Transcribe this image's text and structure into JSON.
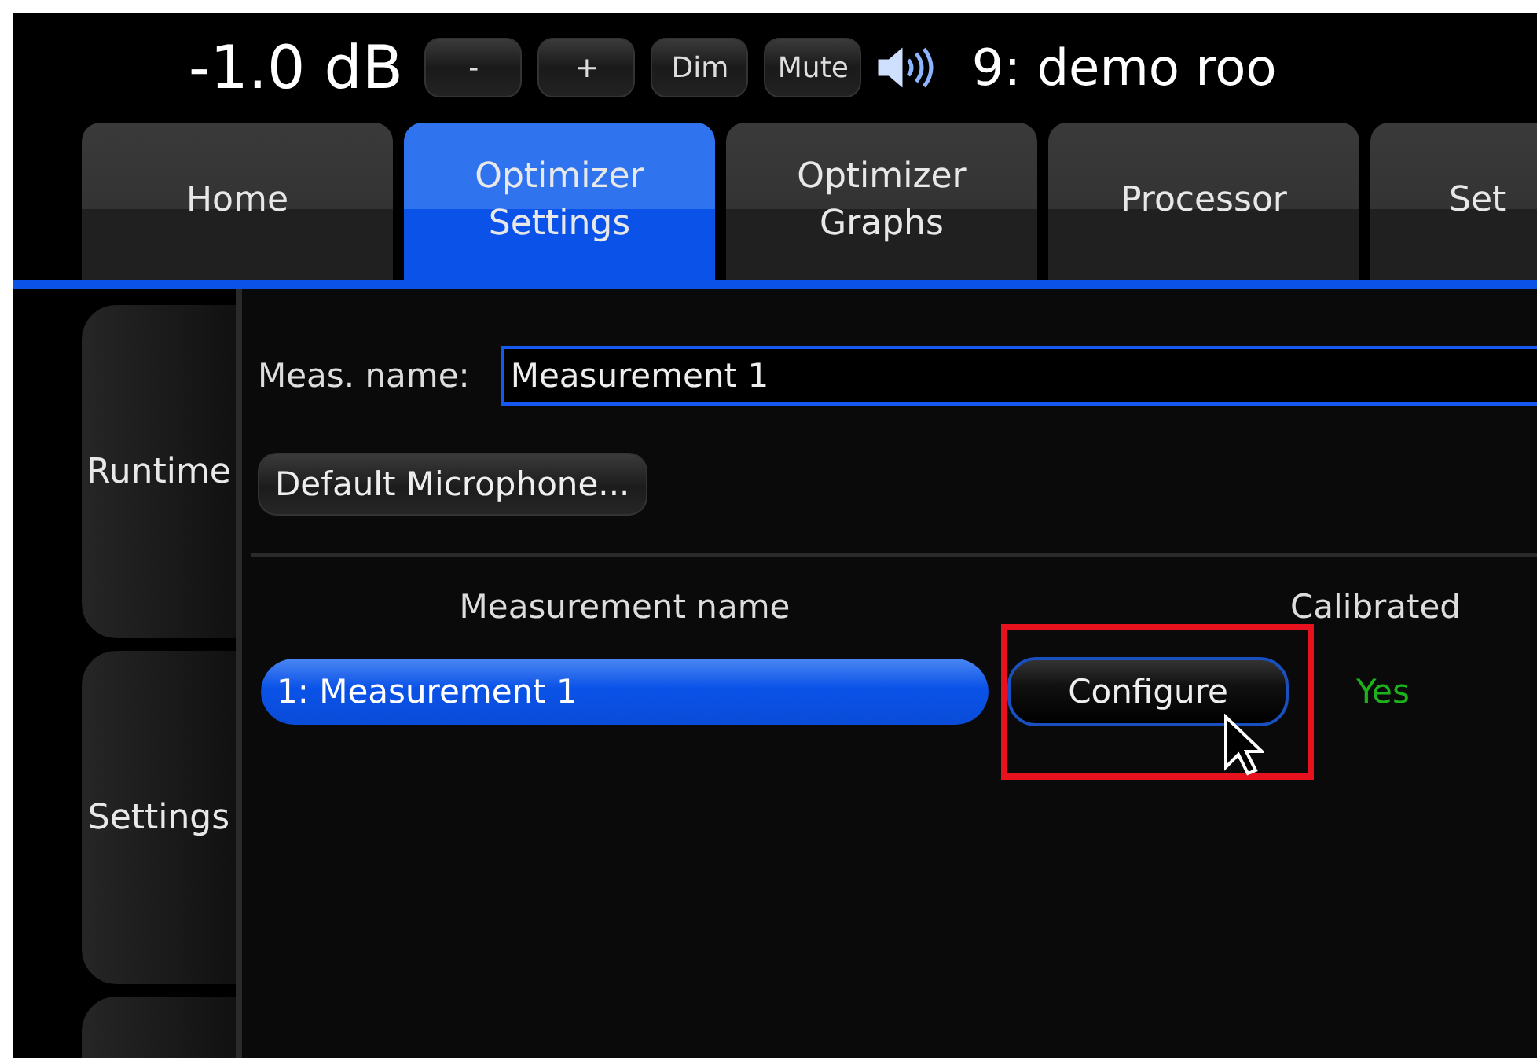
{
  "level_display": "-1.0 dB",
  "volume_buttons": [
    {
      "label": "-"
    },
    {
      "label": "+"
    },
    {
      "label": "Dim"
    },
    {
      "label": "Mute"
    }
  ],
  "room": "9: demo roo",
  "tabs": [
    {
      "label": "Home",
      "selected": false
    },
    {
      "label": "Optimizer\nSettings",
      "selected": true
    },
    {
      "label": "Optimizer\nGraphs",
      "selected": false
    },
    {
      "label": "Processor",
      "selected": false
    },
    {
      "label": "Set",
      "selected": false
    }
  ],
  "side_tabs": [
    {
      "label": "Runtime"
    },
    {
      "label": "Settings"
    }
  ],
  "meas_name": {
    "label": "Meas. name:",
    "value": "Measurement 1"
  },
  "mic_button": "Default Microphone...",
  "table": {
    "columns": [
      "Measurement name",
      "Calibrated"
    ],
    "rows": [
      {
        "name": "1: Measurement 1",
        "selected": true,
        "action": "Configure",
        "calibrated": "Yes"
      }
    ]
  }
}
